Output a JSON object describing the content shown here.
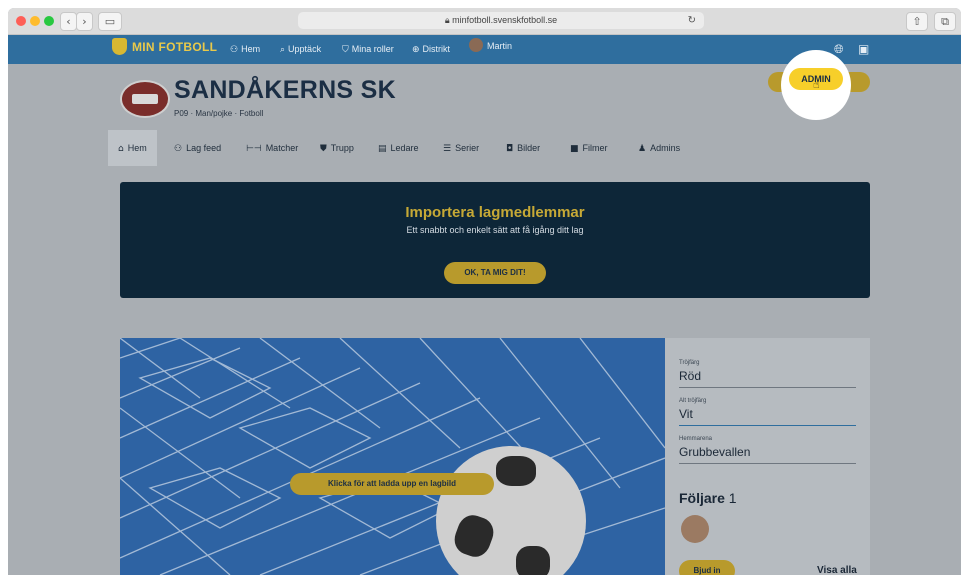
{
  "browser": {
    "url": "minfotboll.svenskfotboll.se",
    "back_icon": "chevron-left-icon",
    "forward_icon": "chevron-right-icon"
  },
  "nav": {
    "brand": "MIN FOTBOLL",
    "items": [
      {
        "label": "Hem",
        "icon": "team-icon"
      },
      {
        "label": "Upptäck",
        "icon": "search-icon"
      },
      {
        "label": "Mina roller",
        "icon": "shield-icon"
      },
      {
        "label": "Distrikt",
        "icon": "district-icon"
      },
      {
        "label": "Martin",
        "icon": "avatar"
      }
    ]
  },
  "team": {
    "name": "SANDÅKERNS SK",
    "meta": "P09 · Man/pojke · Fotboll",
    "admin_label": "ADMIN"
  },
  "tabs": [
    {
      "label": "Hem",
      "icon": "home-icon",
      "active": true
    },
    {
      "label": "Lag feed",
      "icon": "team-icon"
    },
    {
      "label": "Matcher",
      "icon": "versus-icon"
    },
    {
      "label": "Trupp",
      "icon": "shirt-icon"
    },
    {
      "label": "Ledare",
      "icon": "clipboard-icon"
    },
    {
      "label": "Serier",
      "icon": "list-icon"
    },
    {
      "label": "Bilder",
      "icon": "camera-icon"
    },
    {
      "label": "Filmer",
      "icon": "video-icon"
    },
    {
      "label": "Admins",
      "icon": "person-icon"
    }
  ],
  "banner": {
    "title": "Importera lagmedlemmar",
    "subtitle": "Ett snabbt och enkelt sätt att få igång ditt lag",
    "button": "OK, TA MIG DIT!"
  },
  "photo": {
    "upload_label": "Klicka för att ladda upp en lagbild"
  },
  "info": {
    "fields": [
      {
        "label": "Tröjfärg",
        "value": "Röd"
      },
      {
        "label": "Alt tröjfärg",
        "value": "Vit"
      },
      {
        "label": "Hemmarena",
        "value": "Grubbevallen"
      }
    ],
    "followers_label": "Följare",
    "followers_count": "1",
    "invite_label": "Bjud in",
    "show_all_label": "Visa alla"
  }
}
